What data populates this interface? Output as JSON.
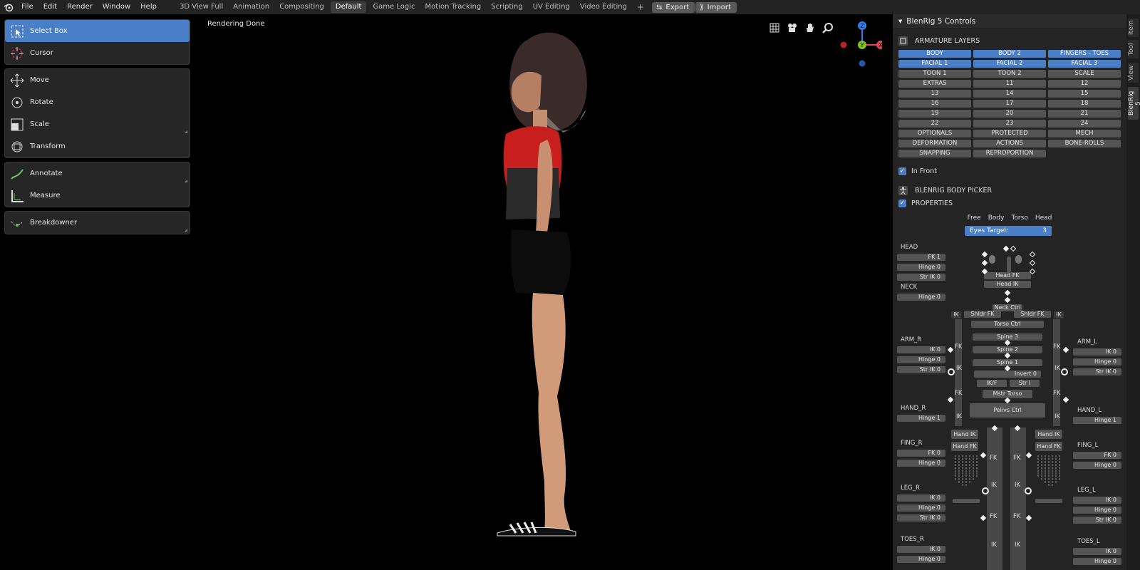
{
  "topbar": {
    "menus": [
      "File",
      "Edit",
      "Render",
      "Window",
      "Help"
    ],
    "workspaces": [
      "3D View Full",
      "Animation",
      "Compositing",
      "Default",
      "Game Logic",
      "Motion Tracking",
      "Scripting",
      "UV Editing",
      "Video Editing"
    ],
    "active_workspace": "Default",
    "add_symbol": "+",
    "export_label": "Export",
    "import_label": "Import"
  },
  "toolbar": {
    "groups": [
      [
        {
          "label": "Select Box",
          "icon": "select-box-icon",
          "selected": true
        },
        {
          "label": "Cursor",
          "icon": "cursor-icon"
        }
      ],
      [
        {
          "label": "Move",
          "icon": "move-icon"
        },
        {
          "label": "Rotate",
          "icon": "rotate-icon"
        },
        {
          "label": "Scale",
          "icon": "scale-icon"
        },
        {
          "label": "Transform",
          "icon": "transform-icon"
        }
      ],
      [
        {
          "label": "Annotate",
          "icon": "annotate-icon"
        },
        {
          "label": "Measure",
          "icon": "measure-icon"
        }
      ],
      [
        {
          "label": "Breakdowner",
          "icon": "breakdowner-icon"
        }
      ]
    ]
  },
  "viewport": {
    "status": "Rendering Done",
    "gizmo": {
      "z": "Z",
      "y": "Y",
      "x": "X"
    }
  },
  "npanel": {
    "title": "BlenRig 5 Controls",
    "tabs": [
      "Item",
      "Tool",
      "View",
      "BlenRig 5"
    ],
    "active_tab": "BlenRig 5",
    "armature_layers_label": "ARMATURE LAYERS",
    "layers": [
      {
        "label": "BODY",
        "on": true
      },
      {
        "label": "BODY 2",
        "on": true
      },
      {
        "label": "FINGERS - TOES",
        "on": true
      },
      {
        "label": "FACIAL 1",
        "on": true
      },
      {
        "label": "FACIAL 2",
        "on": true
      },
      {
        "label": "FACIAL 3",
        "on": true
      },
      {
        "label": "TOON 1"
      },
      {
        "label": "TOON 2"
      },
      {
        "label": "SCALE"
      },
      {
        "label": "EXTRAS"
      },
      {
        "label": "11"
      },
      {
        "label": "12"
      },
      {
        "label": "13"
      },
      {
        "label": "14"
      },
      {
        "label": "15"
      },
      {
        "label": "16"
      },
      {
        "label": "17"
      },
      {
        "label": "18"
      },
      {
        "label": "19"
      },
      {
        "label": "20"
      },
      {
        "label": "21"
      },
      {
        "label": "22"
      },
      {
        "label": "23"
      },
      {
        "label": "24"
      },
      {
        "label": "OPTIONALS"
      },
      {
        "label": "PROTECTED"
      },
      {
        "label": "MECH"
      },
      {
        "label": "DEFORMATION"
      },
      {
        "label": "ACTIONS"
      },
      {
        "label": "BONE-ROLLS"
      },
      {
        "label": "SNAPPING"
      },
      {
        "label": "REPROPORTION"
      }
    ],
    "in_front_label": "In Front",
    "body_picker_label": "BLENRIG BODY PICKER",
    "properties_label": "PROPERTIES",
    "eye_modes": [
      "Free",
      "Body",
      "Torso",
      "Head"
    ],
    "eyes_target_label": "Eyes Target:",
    "eyes_target_value": "3"
  },
  "picker": {
    "head": {
      "label": "HEAD",
      "fk": "FK 1",
      "hinge": "Hinge 0",
      "str_ik": "Str IK 0"
    },
    "neck": {
      "label": "NECK",
      "hinge": "Hinge 0"
    },
    "arm_r": {
      "label": "ARM_R",
      "ik": "IK 0",
      "hinge": "Hinge 0",
      "str_ik": "Str IK 0"
    },
    "arm_l": {
      "label": "ARM_L",
      "ik": "IK 0",
      "hinge": "Hinge 0",
      "str_ik": "Str IK 0"
    },
    "hand_r": {
      "label": "HAND_R",
      "hinge": "Hinge 1"
    },
    "hand_l": {
      "label": "HAND_L",
      "hinge": "Hinge 1"
    },
    "fing_r": {
      "label": "FING_R",
      "fk": "FK 0",
      "hinge": "Hinge 0"
    },
    "fing_l": {
      "label": "FING_L",
      "fk": "FK 0",
      "hinge": "Hinge 0"
    },
    "leg_r": {
      "label": "LEG_R",
      "ik": "IK 0",
      "hinge": "Hinge 0",
      "str_ik": "Str IK 0"
    },
    "leg_l": {
      "label": "LEG_L",
      "ik": "IK 0",
      "hinge": "Hinge 0",
      "str_ik": "Str IK 0"
    },
    "toes_r": {
      "label": "TOES_R",
      "ik": "IK 0",
      "hinge": "Hinge 0"
    },
    "toes_l": {
      "label": "TOES_L",
      "ik": "IK 0",
      "hinge": "Hinge 0"
    },
    "center": {
      "head_fk": "Head FK",
      "head_ik": "Head IK",
      "neck_ctrl": "Neck Ctrl",
      "shldr_fk_r": "Shldr FK",
      "shldr_fk_l": "Shldr FK",
      "ik": "IK",
      "fk": "FK",
      "torso_ctrl": "Torso Ctrl",
      "spine3": "Spine 3",
      "spine2": "Spine 2",
      "spine1": "Spine 1",
      "invert": "Invert 0",
      "ikf": "IK/F",
      "str_i": "Str I",
      "mstr_torso": "Mstr Torso",
      "pelvis_ctrl": "Pelivs Ctrl",
      "hand_ik": "Hand IK",
      "hand_fk": "Hand FK"
    }
  },
  "colors": {
    "accent": "#4a7ec7",
    "panel": "#242424",
    "topbar": "#232323",
    "button": "#545454",
    "gizmo_x": "#e0454f",
    "gizmo_y": "#7fbf1e",
    "gizmo_z": "#2f7fe8"
  }
}
